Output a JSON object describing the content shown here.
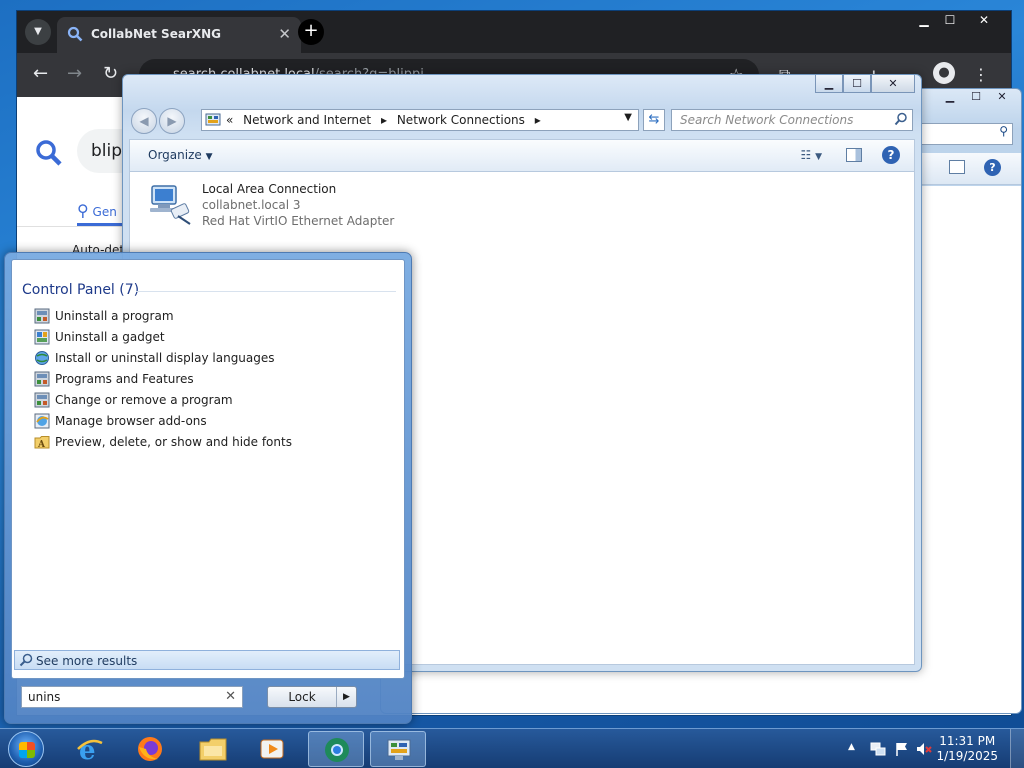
{
  "browser": {
    "tab_title": "CollabNet SearXNG",
    "url_host": "search.collabnet.local",
    "url_path": "/search?q=blippi",
    "query_text": "blipp",
    "category_tab": "Gen",
    "language_label": "Auto-dete"
  },
  "network_window": {
    "breadcrumb_root": "«",
    "breadcrumb_1": "Network and Internet",
    "breadcrumb_2": "Network Connections",
    "search_placeholder": "Search Network Connections",
    "organize_label": "Organize",
    "connection": {
      "name": "Local Area Connection",
      "network": "collabnet.local  3",
      "adapter": "Red Hat VirtIO Ethernet Adapter"
    }
  },
  "start_menu": {
    "group_header": "Control Panel (7)",
    "items": [
      {
        "label": "Uninstall a program",
        "icon": "programs-icon"
      },
      {
        "label": "Uninstall a gadget",
        "icon": "gadget-icon"
      },
      {
        "label": "Install or uninstall display languages",
        "icon": "globe-icon"
      },
      {
        "label": "Programs and Features",
        "icon": "programs-icon"
      },
      {
        "label": "Change or remove a program",
        "icon": "programs-icon"
      },
      {
        "label": "Manage browser add-ons",
        "icon": "internet-options-icon"
      },
      {
        "label": "Preview, delete, or show and hide fonts",
        "icon": "fonts-folder-icon"
      }
    ],
    "see_more": "See more results",
    "search_value": "unins",
    "lock_label": "Lock"
  },
  "taskbar": {
    "time": "11:31 PM",
    "date": "1/19/2025",
    "pinned": [
      "internet-explorer-icon",
      "firefox-icon",
      "file-explorer-icon",
      "media-player-icon",
      "chrome-icon",
      "network-control-panel-icon"
    ]
  }
}
